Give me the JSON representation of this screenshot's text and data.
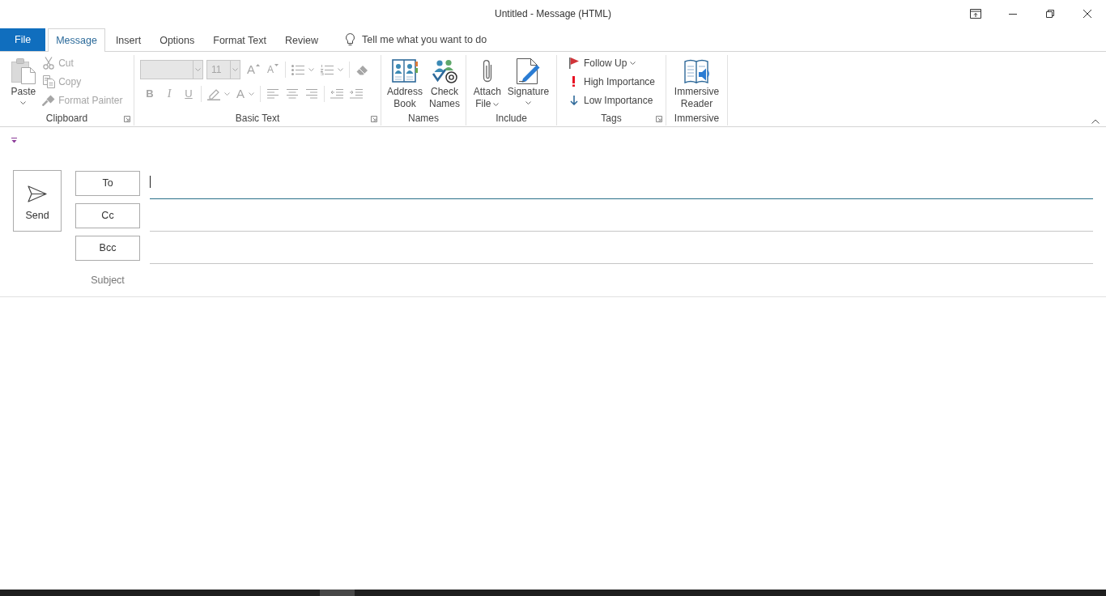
{
  "window": {
    "title": "Untitled - Message (HTML)"
  },
  "tabs": [
    {
      "label": "File",
      "kind": "backstage",
      "selected": false
    },
    {
      "label": "Message",
      "kind": "tab",
      "selected": true
    },
    {
      "label": "Insert",
      "kind": "tab",
      "selected": false
    },
    {
      "label": "Options",
      "kind": "tab",
      "selected": false
    },
    {
      "label": "Format Text",
      "kind": "tab",
      "selected": false
    },
    {
      "label": "Review",
      "kind": "tab",
      "selected": false
    }
  ],
  "tell_me": {
    "placeholder": "Tell me what you want to do"
  },
  "ribbon": {
    "groups": [
      {
        "label": "Clipboard",
        "kind": "columns",
        "launcher": true,
        "columns": [
          {
            "kind": "large",
            "items": [
              {
                "kind": "paste",
                "lines": [
                  "Paste"
                ],
                "dropdown": true,
                "disabled": false
              }
            ]
          },
          {
            "kind": "stack",
            "items": [
              {
                "kind": "cut",
                "label": "Cut",
                "dropdown": false,
                "disabled": true
              },
              {
                "kind": "copy",
                "label": "Copy",
                "dropdown": false,
                "disabled": true
              },
              {
                "kind": "painter",
                "label": "Format Painter",
                "dropdown": false,
                "disabled": true
              }
            ]
          }
        ]
      },
      {
        "label": "Basic Text",
        "kind": "rows",
        "launcher": true,
        "rows": [
          {
            "clusters": [
              {
                "items": [
                  {
                    "kind": "fontname",
                    "dropdown": true,
                    "disabled": true
                  },
                  {
                    "kind": "fontsize",
                    "value": "11",
                    "dropdown": true,
                    "disabled": true
                  },
                  {
                    "kind": "grow",
                    "label": "A",
                    "dropdown": false,
                    "disabled": true
                  },
                  {
                    "kind": "shrink",
                    "label": "A",
                    "dropdown": false,
                    "disabled": true
                  }
                ]
              },
              {
                "items": [
                  {
                    "kind": "bullets",
                    "dropdown": true,
                    "disabled": true
                  },
                  {
                    "kind": "numbering",
                    "dropdown": true,
                    "disabled": true
                  }
                ]
              },
              {
                "items": [
                  {
                    "kind": "clear",
                    "dropdown": false,
                    "disabled": true
                  }
                ]
              }
            ]
          },
          {
            "clusters": [
              {
                "items": [
                  {
                    "kind": "bold",
                    "label": "B",
                    "dropdown": false,
                    "disabled": true
                  },
                  {
                    "kind": "italic",
                    "label": "I",
                    "dropdown": false,
                    "disabled": true
                  },
                  {
                    "kind": "underline",
                    "label": "U",
                    "dropdown": false,
                    "disabled": true
                  }
                ]
              },
              {
                "items": [
                  {
                    "kind": "highlight",
                    "dropdown": true,
                    "disabled": true
                  },
                  {
                    "kind": "fontcolor",
                    "label": "A",
                    "dropdown": true,
                    "disabled": true
                  }
                ]
              },
              {
                "items": [
                  {
                    "kind": "alignleft",
                    "dropdown": false,
                    "disabled": true
                  },
                  {
                    "kind": "center",
                    "dropdown": false,
                    "disabled": true
                  },
                  {
                    "kind": "alignright",
                    "dropdown": false,
                    "disabled": true
                  }
                ]
              },
              {
                "items": [
                  {
                    "kind": "outdent",
                    "dropdown": false,
                    "disabled": true
                  },
                  {
                    "kind": "indent",
                    "dropdown": false,
                    "disabled": true
                  }
                ]
              }
            ]
          }
        ]
      },
      {
        "label": "Names",
        "kind": "columns",
        "launcher": false,
        "columns": [
          {
            "kind": "large",
            "items": [
              {
                "kind": "addressbook",
                "lines": [
                  "Address",
                  "Book"
                ],
                "dropdown": false,
                "disabled": false
              }
            ]
          },
          {
            "kind": "large",
            "items": [
              {
                "kind": "checknames",
                "lines": [
                  "Check",
                  "Names"
                ],
                "dropdown": false,
                "disabled": false
              }
            ]
          }
        ]
      },
      {
        "label": "Include",
        "kind": "columns",
        "launcher": false,
        "columns": [
          {
            "kind": "large",
            "items": [
              {
                "kind": "attach",
                "lines": [
                  "Attach",
                  "File"
                ],
                "dropdown": true,
                "disabled": false
              }
            ]
          },
          {
            "kind": "large",
            "items": [
              {
                "kind": "signature",
                "lines": [
                  "Signature"
                ],
                "dropdown": true,
                "disabled": false
              }
            ]
          }
        ]
      },
      {
        "label": "Tags",
        "kind": "columns",
        "launcher": true,
        "columns": [
          {
            "kind": "stack",
            "items": [
              {
                "kind": "followup",
                "label": "Follow Up",
                "dropdown": true,
                "disabled": false
              },
              {
                "kind": "high",
                "label": "High Importance",
                "dropdown": false,
                "disabled": false
              },
              {
                "kind": "low",
                "label": "Low Importance",
                "dropdown": false,
                "disabled": false
              }
            ]
          }
        ]
      },
      {
        "label": "Immersive",
        "kind": "columns",
        "launcher": false,
        "columns": [
          {
            "kind": "large",
            "items": [
              {
                "kind": "reader",
                "lines": [
                  "Immersive",
                  "Reader"
                ],
                "dropdown": false,
                "disabled": false
              }
            ]
          }
        ]
      }
    ]
  },
  "compose": {
    "send": {
      "label": "Send"
    },
    "recipients": [
      {
        "label": "To",
        "focused": true
      },
      {
        "label": "Cc",
        "focused": false
      },
      {
        "label": "Bcc",
        "focused": false
      }
    ],
    "subject": {
      "label": "Subject"
    }
  }
}
